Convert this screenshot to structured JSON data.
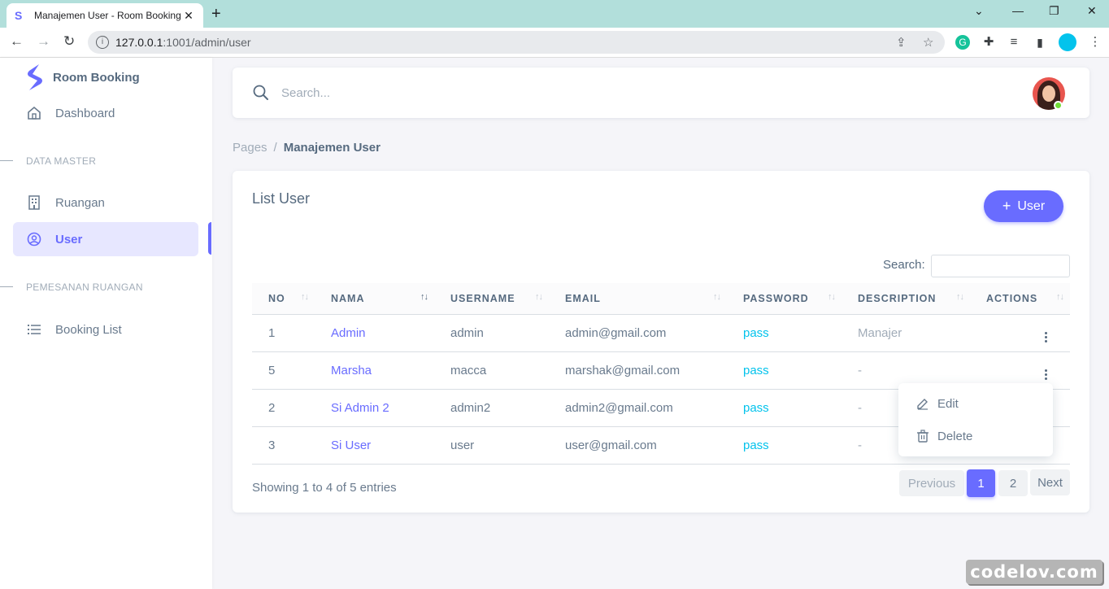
{
  "browser": {
    "tab_title": "Manajemen User - Room Booking",
    "url_host": "127.0.0.1",
    "url_path": ":1001/admin/user"
  },
  "sidebar": {
    "brand": "Room Booking",
    "dashboard_label": "Dashboard",
    "section_data_master": "DATA MASTER",
    "ruangan_label": "Ruangan",
    "user_label": "User",
    "section_pemesanan": "PEMESANAN RUANGAN",
    "booking_list_label": "Booking List"
  },
  "navbar": {
    "search_placeholder": "Search..."
  },
  "breadcrumb": {
    "parent": "Pages",
    "separator": "/",
    "current": "Manajemen User"
  },
  "card": {
    "title": "List User",
    "add_button": "User",
    "search_label": "Search:"
  },
  "table": {
    "columns": [
      "NO",
      "NAMA",
      "USERNAME",
      "EMAIL",
      "PASSWORD",
      "DESCRIPTION",
      "ACTIONS"
    ],
    "rows": [
      {
        "no": "1",
        "nama": "Admin",
        "username": "admin",
        "email": "admin@gmail.com",
        "password": "pass",
        "description": "Manajer"
      },
      {
        "no": "5",
        "nama": "Marsha",
        "username": "macca",
        "email": "marshak@gmail.com",
        "password": "pass",
        "description": "-"
      },
      {
        "no": "2",
        "nama": "Si Admin 2",
        "username": "admin2",
        "email": "admin2@gmail.com",
        "password": "pass",
        "description": "-"
      },
      {
        "no": "3",
        "nama": "Si User",
        "username": "user",
        "email": "user@gmail.com",
        "password": "pass",
        "description": "-"
      }
    ]
  },
  "footer": {
    "info": "Showing 1 to 4 of 5 entries",
    "previous": "Previous",
    "page1": "1",
    "page2": "2",
    "next": "Next"
  },
  "dropdown": {
    "edit": "Edit",
    "delete": "Delete"
  },
  "watermark": "codelov.com",
  "colors": {
    "primary": "#696cff",
    "info": "#03c3ec",
    "text": "#697a8d",
    "tabbar": "#b2dfdb"
  },
  "icons": [
    "search-icon",
    "home-icon",
    "building-icon",
    "user-circle-icon",
    "list-icon",
    "pencil-icon",
    "trash-icon",
    "kebab-icon"
  ]
}
